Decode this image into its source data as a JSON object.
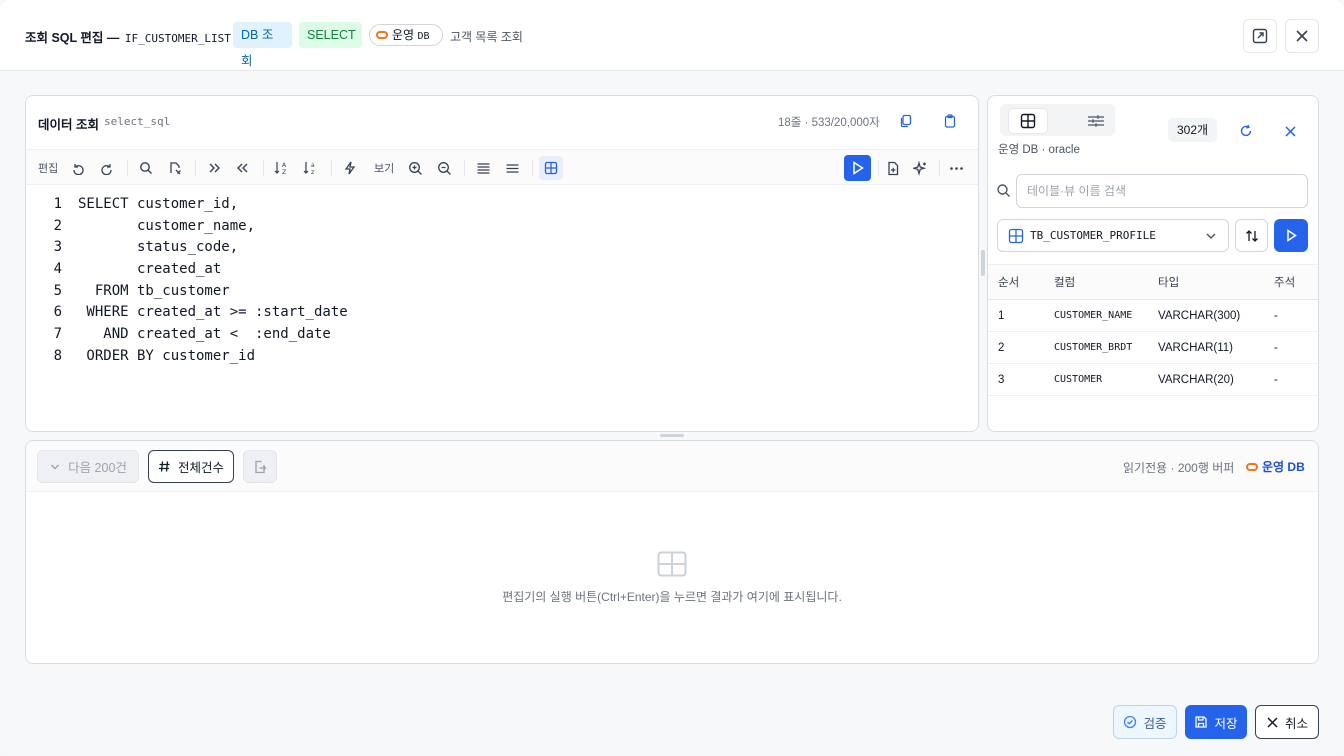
{
  "header": {
    "title": "조회 SQL 편집 —",
    "interface_id": "IF_CUSTOMER_LIST",
    "badge_db": "DB 조회",
    "badge_select": "SELECT",
    "env_label": "운영",
    "env_suffix": "DB",
    "subtitle": "고객 목록 조회"
  },
  "editor": {
    "title": "데이터 조회",
    "field_name": "select_sql",
    "stats": "18줄 · 533/20,000자",
    "toolbar": {
      "edit_label": "편집",
      "view_label": "보기"
    },
    "code_lines": [
      {
        "num": "1",
        "text": "SELECT customer_id,"
      },
      {
        "num": "2",
        "text": "       customer_name,"
      },
      {
        "num": "3",
        "text": "       status_code,"
      },
      {
        "num": "4",
        "text": "       created_at"
      },
      {
        "num": "5",
        "text": "  FROM tb_customer"
      },
      {
        "num": "6",
        "text": " WHERE created_at >= :start_date"
      },
      {
        "num": "7",
        "text": "   AND created_at <  :end_date"
      },
      {
        "num": "8",
        "text": " ORDER BY customer_id"
      }
    ]
  },
  "schema_panel": {
    "count": "302개",
    "db_info": "운영 DB · oracle",
    "search_placeholder": "테이블·뷰 이름 검색",
    "selected_table": "TB_CUSTOMER_PROFILE",
    "columns": [
      "순서",
      "컬럼",
      "타입",
      "주석"
    ],
    "rows": [
      [
        "1",
        "CUSTOMER_NAME",
        "VARCHAR(300)",
        "-"
      ],
      [
        "2",
        "CUSTOMER_BRDT",
        "VARCHAR(11)",
        "-"
      ],
      [
        "3",
        "CUSTOMER",
        "VARCHAR(20)",
        "-"
      ]
    ]
  },
  "result": {
    "next_label": "다음 200건",
    "total_label": "전체건수",
    "info": "읽기전용 · 200행 버퍼",
    "env": "운영 DB",
    "empty_message": "편집기의 실행 버튼(Ctrl+Enter)을 누르면 결과가 여기에 표시됩니다."
  },
  "footer": {
    "verify_label": "검증",
    "save_label": "저장",
    "cancel_label": "취소"
  },
  "colors": {
    "accent": "#2563eb",
    "env_orange": "#f97316",
    "select_green": "#15803d",
    "db_blue": "#0369a1"
  }
}
